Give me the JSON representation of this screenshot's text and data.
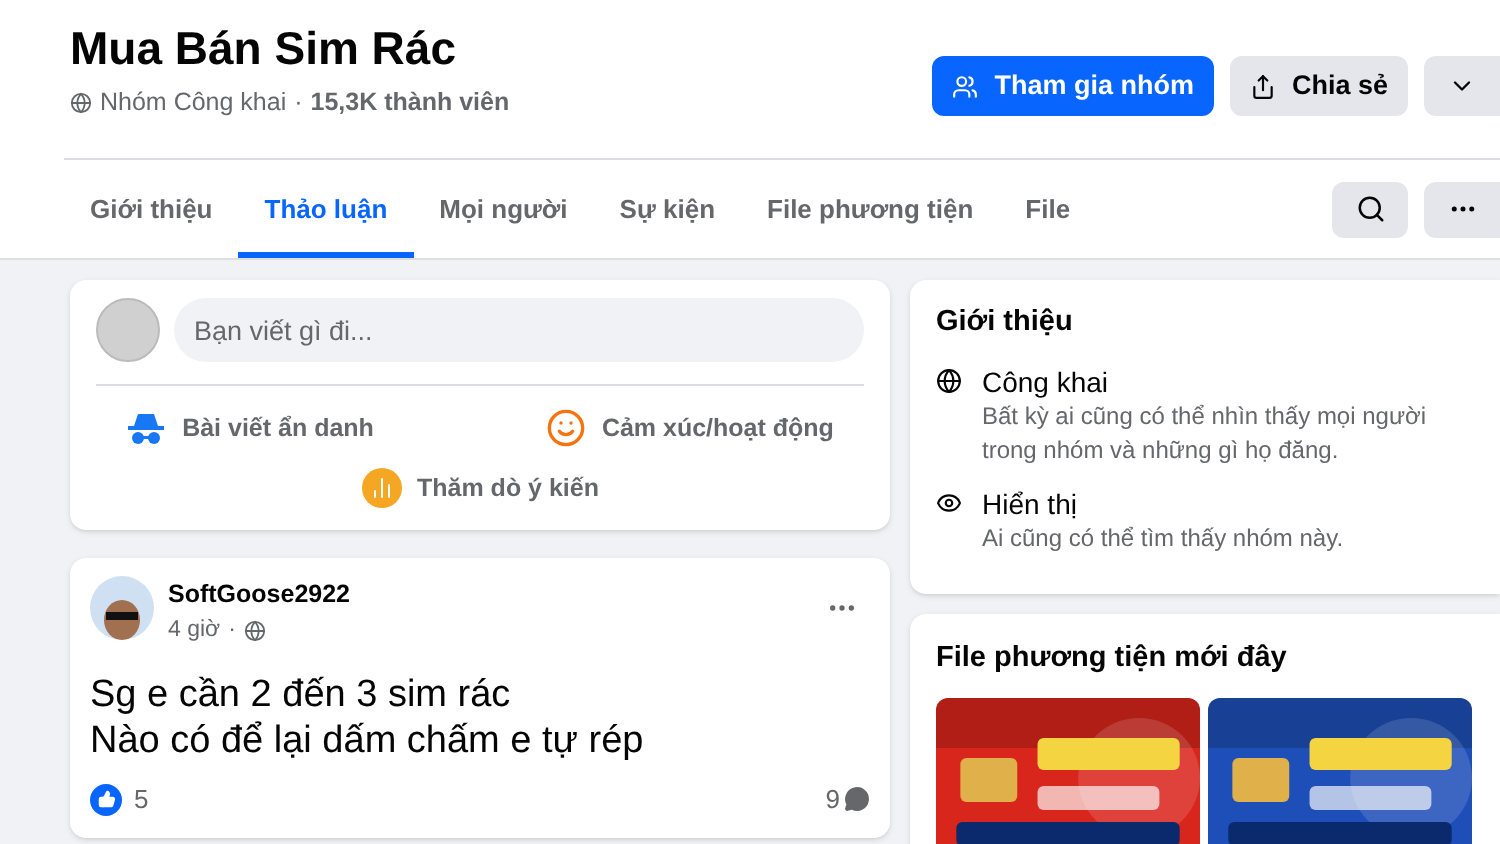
{
  "group": {
    "title": "Mua Bán Sim Rác",
    "privacy": "Nhóm Công khai",
    "separator": "·",
    "members": "15,3K thành viên"
  },
  "actions": {
    "join": "Tham gia nhóm",
    "share": "Chia sẻ"
  },
  "tabs": [
    {
      "label": "Giới thiệu",
      "selected": false
    },
    {
      "label": "Thảo luận",
      "selected": true
    },
    {
      "label": "Mọi người",
      "selected": false
    },
    {
      "label": "Sự kiện",
      "selected": false
    },
    {
      "label": "File phương tiện",
      "selected": false
    },
    {
      "label": "File",
      "selected": false
    }
  ],
  "composer": {
    "placeholder": "Bạn viết gì đi...",
    "options": [
      {
        "kind": "anonymous",
        "label": "Bài viết ẩn danh"
      },
      {
        "kind": "feeling",
        "label": "Cảm xúc/hoạt động"
      },
      {
        "kind": "poll",
        "label": "Thăm dò ý kiến"
      }
    ]
  },
  "post": {
    "author": "SoftGoose2922",
    "time": "4 giờ",
    "separator": "·",
    "lines": [
      "Sg e cần 2 đến 3 sim rác",
      "Nào có để lại dấm chấm e tự rép"
    ],
    "likes": "5",
    "comments": "9"
  },
  "about": {
    "title": "Giới thiệu",
    "items": [
      {
        "kind": "globe",
        "title": "Công khai",
        "text": "Bất kỳ ai cũng có thể nhìn thấy mọi người trong nhóm và những gì họ đăng."
      },
      {
        "kind": "eye",
        "title": "Hiển thị",
        "text": "Ai cũng có thể tìm thấy nhóm này."
      }
    ]
  },
  "media": {
    "title": "File phương tiện mới đây"
  }
}
